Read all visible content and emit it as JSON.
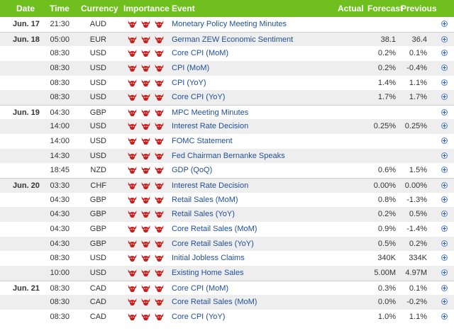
{
  "colors": {
    "header_bg": "#6fbf1f",
    "bull": "#c8201e",
    "event_link": "#1f4e9c",
    "row_alt": "#eeeeee"
  },
  "header": {
    "date": "Date",
    "time": "Time",
    "currency": "Currency",
    "importance": "Importance",
    "event": "Event",
    "actual": "Actual",
    "forecast": "Forecast",
    "previous": "Previous"
  },
  "rows": [
    {
      "date": "Jun. 17",
      "time": "21:30",
      "currency": "AUD",
      "event": "Monetary Policy Meeting Minutes",
      "actual": "",
      "forecast": "",
      "previous": "",
      "importance": 3
    },
    {
      "date": "Jun. 18",
      "time": "05:00",
      "currency": "EUR",
      "event": "German ZEW Economic Sentiment",
      "actual": "",
      "forecast": "38.1",
      "previous": "36.4",
      "importance": 3
    },
    {
      "date": "",
      "time": "08:30",
      "currency": "USD",
      "event": "Core CPI (MoM)",
      "actual": "",
      "forecast": "0.2%",
      "previous": "0.1%",
      "importance": 3
    },
    {
      "date": "",
      "time": "08:30",
      "currency": "USD",
      "event": "CPI (MoM)",
      "actual": "",
      "forecast": "0.2%",
      "previous": "-0.4%",
      "importance": 3
    },
    {
      "date": "",
      "time": "08:30",
      "currency": "USD",
      "event": "CPI (YoY)",
      "actual": "",
      "forecast": "1.4%",
      "previous": "1.1%",
      "importance": 3
    },
    {
      "date": "",
      "time": "08:30",
      "currency": "USD",
      "event": "Core CPI (YoY)",
      "actual": "",
      "forecast": "1.7%",
      "previous": "1.7%",
      "importance": 3
    },
    {
      "date": "Jun. 19",
      "time": "04:30",
      "currency": "GBP",
      "event": "MPC Meeting Minutes",
      "actual": "",
      "forecast": "",
      "previous": "",
      "importance": 3
    },
    {
      "date": "",
      "time": "14:00",
      "currency": "USD",
      "event": "Interest Rate Decision",
      "actual": "",
      "forecast": "0.25%",
      "previous": "0.25%",
      "importance": 3
    },
    {
      "date": "",
      "time": "14:00",
      "currency": "USD",
      "event": "FOMC Statement",
      "actual": "",
      "forecast": "",
      "previous": "",
      "importance": 3
    },
    {
      "date": "",
      "time": "14:30",
      "currency": "USD",
      "event": "Fed Chairman Bernanke Speaks",
      "actual": "",
      "forecast": "",
      "previous": "",
      "importance": 3
    },
    {
      "date": "",
      "time": "18:45",
      "currency": "NZD",
      "event": "GDP (QoQ)",
      "actual": "",
      "forecast": "0.6%",
      "previous": "1.5%",
      "importance": 3
    },
    {
      "date": "Jun. 20",
      "time": "03:30",
      "currency": "CHF",
      "event": "Interest Rate Decision",
      "actual": "",
      "forecast": "0.00%",
      "previous": "0.00%",
      "importance": 3
    },
    {
      "date": "",
      "time": "04:30",
      "currency": "GBP",
      "event": "Retail Sales (MoM)",
      "actual": "",
      "forecast": "0.8%",
      "previous": "-1.3%",
      "importance": 3
    },
    {
      "date": "",
      "time": "04:30",
      "currency": "GBP",
      "event": "Retail Sales (YoY)",
      "actual": "",
      "forecast": "0.2%",
      "previous": "0.5%",
      "importance": 3
    },
    {
      "date": "",
      "time": "04:30",
      "currency": "GBP",
      "event": "Core Retail Sales (MoM)",
      "actual": "",
      "forecast": "0.9%",
      "previous": "-1.4%",
      "importance": 3
    },
    {
      "date": "",
      "time": "04:30",
      "currency": "GBP",
      "event": "Core Retail Sales (YoY)",
      "actual": "",
      "forecast": "0.5%",
      "previous": "0.2%",
      "importance": 3
    },
    {
      "date": "",
      "time": "08:30",
      "currency": "USD",
      "event": "Initial Jobless Claims",
      "actual": "",
      "forecast": "340K",
      "previous": "334K",
      "importance": 3
    },
    {
      "date": "",
      "time": "10:00",
      "currency": "USD",
      "event": "Existing Home Sales",
      "actual": "",
      "forecast": "5.00M",
      "previous": "4.97M",
      "importance": 3
    },
    {
      "date": "Jun. 21",
      "time": "08:30",
      "currency": "CAD",
      "event": "Core CPI (MoM)",
      "actual": "",
      "forecast": "0.3%",
      "previous": "0.1%",
      "importance": 3
    },
    {
      "date": "",
      "time": "08:30",
      "currency": "CAD",
      "event": "Core Retail Sales (MoM)",
      "actual": "",
      "forecast": "0.0%",
      "previous": "-0.2%",
      "importance": 3
    },
    {
      "date": "",
      "time": "08:30",
      "currency": "CAD",
      "event": "Core CPI (YoY)",
      "actual": "",
      "forecast": "1.0%",
      "previous": "1.1%",
      "importance": 3
    }
  ]
}
